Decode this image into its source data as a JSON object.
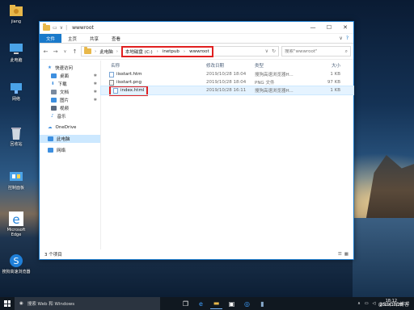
{
  "desktop": {
    "icons": [
      {
        "label": "jiang",
        "icon": "user-folder-icon",
        "color": "#e8b84a"
      },
      {
        "label": "此电脑",
        "icon": "computer-icon",
        "color": "#4aa3e8"
      },
      {
        "label": "网络",
        "icon": "network-icon",
        "color": "#4aa3e8"
      },
      {
        "label": "回收站",
        "icon": "recycle-bin-icon",
        "color": "#cfd8e0"
      },
      {
        "label": "控制面板",
        "icon": "control-panel-icon",
        "color": "#4aa3e8"
      },
      {
        "label": "Microsoft Edge",
        "icon": "edge-icon",
        "color": "#1f7fd8"
      },
      {
        "label": "搜狗高速浏览器",
        "icon": "sogou-browser-icon",
        "color": "#1f7fd8"
      }
    ]
  },
  "window": {
    "title": "wwwroot",
    "tabs": [
      "文件",
      "主页",
      "共享",
      "查看"
    ],
    "address": {
      "root": "此电脑",
      "highlighted": [
        "本地磁盘 (C:)",
        "inetpub",
        "wwwroot"
      ]
    },
    "search_placeholder": "搜索\"wwwroot\"",
    "nav": [
      {
        "label": "快速访问",
        "icon": "star-icon",
        "color": "#3d8fe0",
        "level": 0,
        "pinned": false
      },
      {
        "label": "桌面",
        "icon": "desktop-icon",
        "color": "#3d8fe0",
        "level": 1,
        "pinned": true
      },
      {
        "label": "下载",
        "icon": "download-icon",
        "color": "#3d8fe0",
        "level": 1,
        "pinned": true
      },
      {
        "label": "文档",
        "icon": "document-icon",
        "color": "#7a8aa0",
        "level": 1,
        "pinned": true
      },
      {
        "label": "图片",
        "icon": "picture-icon",
        "color": "#3d8fe0",
        "level": 1,
        "pinned": true
      },
      {
        "label": "视频",
        "icon": "video-icon",
        "color": "#5a6a80",
        "level": 1,
        "pinned": false
      },
      {
        "label": "音乐",
        "icon": "music-icon",
        "color": "#3d8fe0",
        "level": 1,
        "pinned": false
      },
      {
        "label": "OneDrive",
        "icon": "onedrive-icon",
        "color": "#3d8fe0",
        "level": 0,
        "pinned": false
      },
      {
        "label": "此电脑",
        "icon": "computer-icon",
        "color": "#3d8fe0",
        "level": 0,
        "pinned": false,
        "selected": true
      },
      {
        "label": "网络",
        "icon": "network-icon",
        "color": "#3d8fe0",
        "level": 0,
        "pinned": false
      }
    ],
    "columns": {
      "name": "名称",
      "date": "修改日期",
      "type": "类型",
      "size": "大小"
    },
    "files": [
      {
        "name": "iisstart.htm",
        "date": "2019/10/28 18:04",
        "type": "搜狗高速浏览器H...",
        "size": "1 KB"
      },
      {
        "name": "iisstart.png",
        "date": "2019/10/28 18:04",
        "type": "PNG 文件",
        "size": "97 KB"
      },
      {
        "name": "index.html",
        "date": "2019/10/28 16:11",
        "type": "搜狗高速浏览器H...",
        "size": "1 KB",
        "selected": true
      }
    ],
    "status": "3 个项目"
  },
  "taskbar": {
    "search_text": "搜索 Web 和 Windows",
    "apps": [
      "task-view-icon",
      "edge-icon",
      "file-explorer-icon",
      "store-icon",
      "sogou-icon",
      "app-icon"
    ],
    "clock_time": "18:12",
    "clock_date": "2019/10/28"
  },
  "watermark": "@51CTO博客",
  "colors": {
    "accent": "#1979ca",
    "highlight": "#e02020",
    "selection": "#cce8ff"
  }
}
